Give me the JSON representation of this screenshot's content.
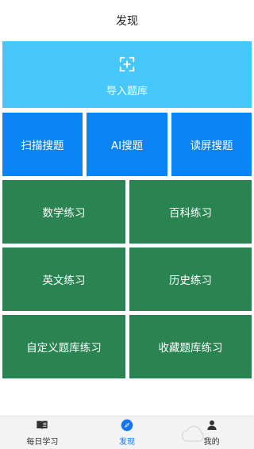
{
  "header": {
    "title": "发现"
  },
  "import_tile": {
    "label": "导入题库",
    "icon": "add-frame-icon"
  },
  "search_tiles": [
    {
      "label": "扫描搜题"
    },
    {
      "label": "AI搜题"
    },
    {
      "label": "读屏搜题"
    }
  ],
  "practice_tiles": [
    {
      "label": "数学练习"
    },
    {
      "label": "百科练习"
    },
    {
      "label": "英文练习"
    },
    {
      "label": "历史练习"
    },
    {
      "label": "自定义题库练习"
    },
    {
      "label": "收藏题库练习"
    }
  ],
  "bottom_nav": {
    "items": [
      {
        "label": "每日学习",
        "icon": "book-icon"
      },
      {
        "label": "发现",
        "icon": "compass-icon",
        "active": true
      },
      {
        "label": "我的",
        "icon": "person-icon"
      }
    ]
  },
  "colors": {
    "import_tile": "#46c8fc",
    "search_tile": "#0a84f5",
    "practice_tile": "#2a8451",
    "nav_active": "#1677f5"
  }
}
